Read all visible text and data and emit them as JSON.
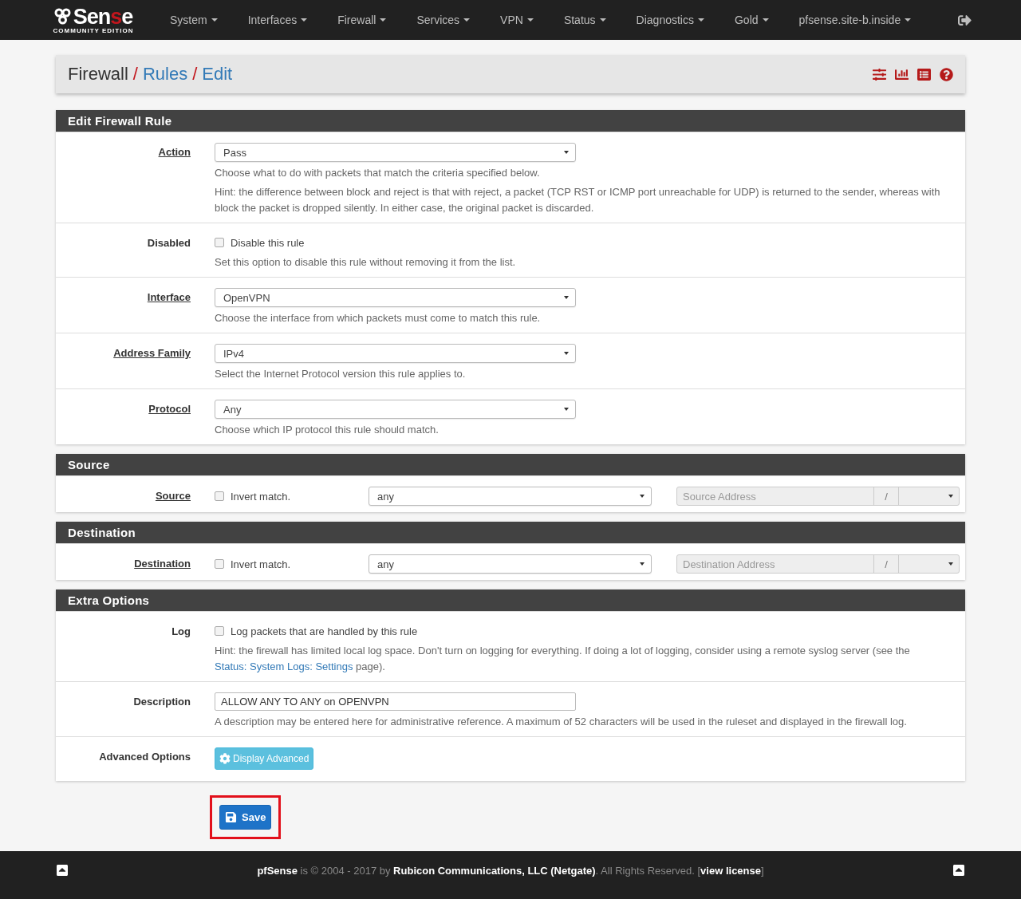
{
  "navbar": {
    "logo": {
      "word_start": "Sen",
      "word_accent": "s",
      "word_end": "e",
      "edition": "COMMUNITY EDITION"
    },
    "menu": [
      {
        "label": "System"
      },
      {
        "label": "Interfaces"
      },
      {
        "label": "Firewall"
      },
      {
        "label": "Services"
      },
      {
        "label": "VPN"
      },
      {
        "label": "Status"
      },
      {
        "label": "Diagnostics"
      },
      {
        "label": "Gold"
      },
      {
        "label": "pfsense.site-b.inside"
      }
    ]
  },
  "breadcrumb": [
    {
      "text": "Firewall",
      "link": false,
      "separator": "/"
    },
    {
      "text": "Rules",
      "link": true,
      "separator": "/"
    },
    {
      "text": "Edit",
      "link": true
    }
  ],
  "sections": [
    {
      "title": "Edit Firewall Rule",
      "rows": [
        {
          "kind": "select",
          "label": "Action",
          "underlined": true,
          "value": "Pass",
          "help": [
            {
              "text": "Choose what to do with packets that match the criteria specified below."
            },
            {
              "text": "Hint: the difference between block and reject is that with reject, a packet (TCP RST or ICMP port unreachable for UDP) is returned to the sender, whereas with block the packet is dropped silently. In either case, the original packet is discarded."
            }
          ]
        },
        {
          "kind": "checkbox",
          "label": "Disabled",
          "underlined": false,
          "checked": false,
          "checkbox_label": "Disable this rule",
          "help": [
            {
              "text": "Set this option to disable this rule without removing it from the list."
            }
          ]
        },
        {
          "kind": "select",
          "label": "Interface",
          "underlined": true,
          "value": "OpenVPN",
          "help": [
            {
              "text": "Choose the interface from which packets must come to match this rule."
            }
          ]
        },
        {
          "kind": "select",
          "label": "Address Family",
          "underlined": true,
          "value": "IPv4",
          "help": [
            {
              "text": "Select the Internet Protocol version this rule applies to."
            }
          ]
        },
        {
          "kind": "select",
          "label": "Protocol",
          "underlined": true,
          "value": "Any",
          "help": [
            {
              "text": "Choose which IP protocol this rule should match."
            }
          ]
        }
      ]
    },
    {
      "title": "Source",
      "rows": [
        {
          "kind": "address",
          "label": "Source",
          "underlined": true,
          "checked": false,
          "checkbox_label": "Invert match.",
          "value": "any",
          "placeholder": "Source Address",
          "slash": "/"
        }
      ]
    },
    {
      "title": "Destination",
      "rows": [
        {
          "kind": "address",
          "label": "Destination",
          "underlined": true,
          "checked": false,
          "checkbox_label": "Invert match.",
          "value": "any",
          "placeholder": "Destination Address",
          "slash": "/"
        }
      ]
    },
    {
      "title": "Extra Options",
      "rows": [
        {
          "kind": "checkbox",
          "label": "Log",
          "underlined": false,
          "checked": false,
          "checkbox_label": "Log packets that are handled by this rule",
          "help": [
            {
              "text": "Hint: the firewall has limited local log space. Don't turn on logging for everything. If doing a lot of logging, consider using a remote syslog server (see the",
              "link": "Status: System Logs: Settings",
              "after": "page)."
            }
          ]
        },
        {
          "kind": "text",
          "label": "Description",
          "underlined": false,
          "value": "ALLOW ANY TO ANY on OPENVPN",
          "help": [
            {
              "text": "A description may be entered here for administrative reference. A maximum of 52 characters will be used in the ruleset and displayed in the firewall log."
            }
          ]
        },
        {
          "kind": "button",
          "label": "Advanced Options",
          "underlined": false,
          "button": "Display Advanced"
        }
      ]
    }
  ],
  "save": {
    "label": "Save",
    "highlighted": true
  },
  "footer": {
    "text": "**pfSense** is © 2004 - 2017 by **Rubicon Communications, LLC (Netgate)**. All Rights Reserved. [",
    "link": "view license",
    "after": "]"
  }
}
